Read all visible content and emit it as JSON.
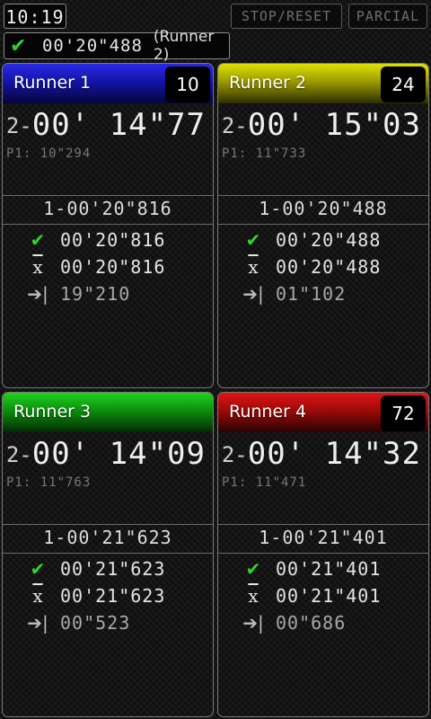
{
  "top": {
    "clock": "10:19",
    "stop_reset": "STOP/RESET",
    "parcial": "PARCIAL"
  },
  "best": {
    "time": "00'20\"488",
    "runner": "(Runner 2)"
  },
  "runners": [
    {
      "name": "Runner 1",
      "number": "10",
      "lap_no": "2-",
      "lap_time": "00' 14\"77",
      "partial": "P1: 10\"294",
      "last_lap": "1-00'20\"816",
      "best": "00'20\"816",
      "average": "00'20\"816",
      "diff": "19\"210"
    },
    {
      "name": "Runner 2",
      "number": "24",
      "lap_no": "2-",
      "lap_time": "00' 15\"03",
      "partial": "P1: 11\"733",
      "last_lap": "1-00'20\"488",
      "best": "00'20\"488",
      "average": "00'20\"488",
      "diff": "01\"102"
    },
    {
      "name": "Runner 3",
      "number": "",
      "lap_no": "2-",
      "lap_time": "00' 14\"09",
      "partial": "P1: 11\"763",
      "last_lap": "1-00'21\"623",
      "best": "00'21\"623",
      "average": "00'21\"623",
      "diff": "00\"523"
    },
    {
      "name": "Runner 4",
      "number": "72",
      "lap_no": "2-",
      "lap_time": "00' 14\"32",
      "partial": "P1: 11\"471",
      "last_lap": "1-00'21\"401",
      "best": "00'21\"401",
      "average": "00'21\"401",
      "diff": "00\"686"
    }
  ],
  "icons": {
    "best": "check-icon",
    "average": "average-x-bar-icon",
    "diff": "arrow-to-bar-icon"
  },
  "colors": {
    "runner1": "#1c1ccc",
    "runner2": "#c8c800",
    "runner3": "#14b814",
    "runner4": "#c81010",
    "check": "#32d232"
  }
}
